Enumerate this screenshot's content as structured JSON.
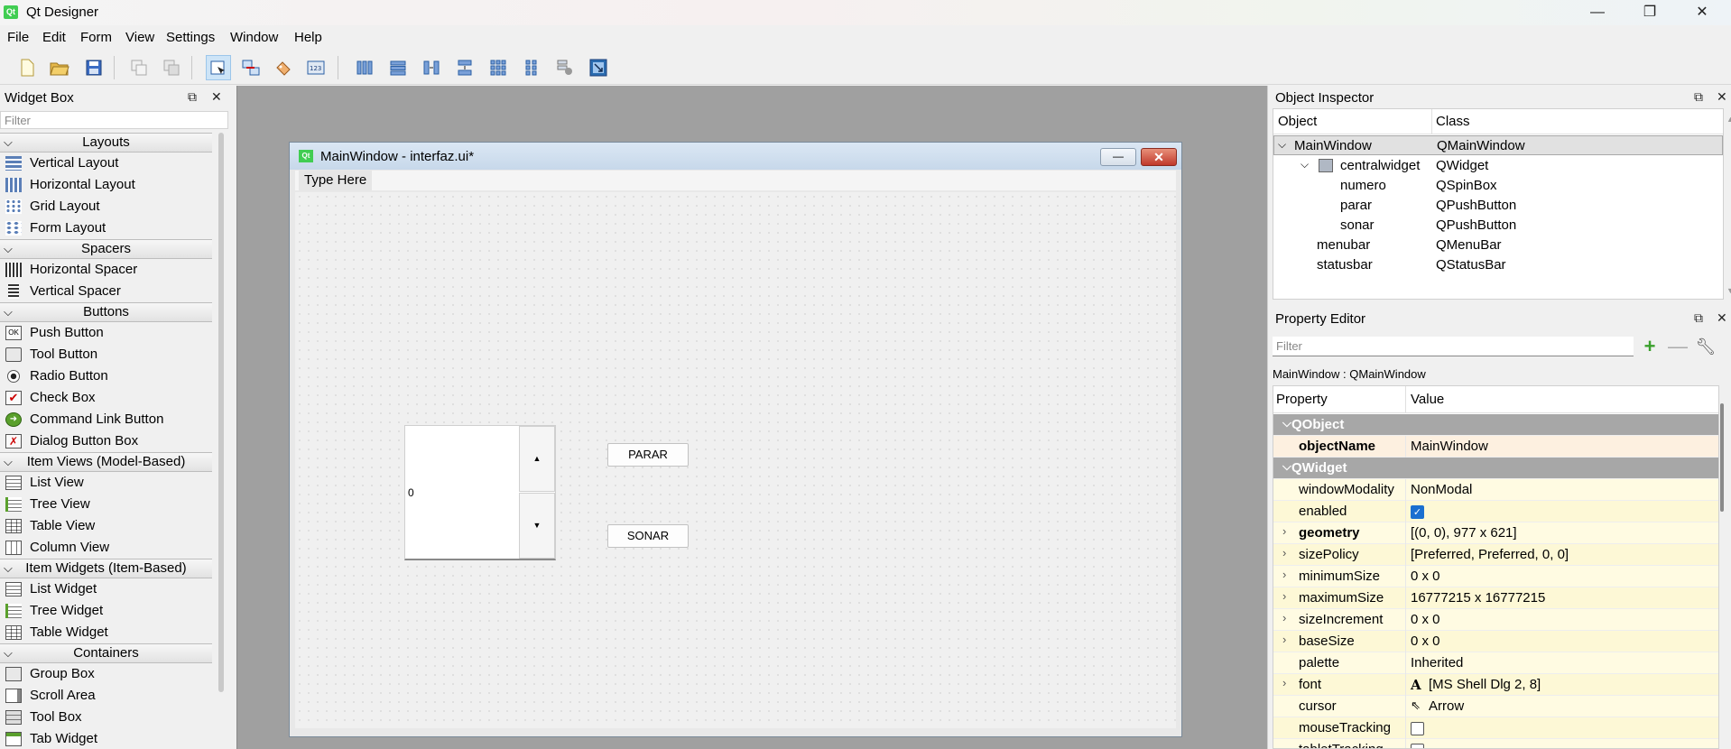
{
  "window": {
    "title": "Qt Designer",
    "icon_text": "Qt",
    "controls": {
      "minimize": "—",
      "maximize": "❐",
      "close": "✕"
    }
  },
  "menubar": [
    "File",
    "Edit",
    "Form",
    "View",
    "Settings",
    "Window",
    "Help"
  ],
  "widget_box": {
    "title": "Widget Box",
    "filter_placeholder": "Filter",
    "categories": [
      {
        "name": "Layouts",
        "items": [
          "Vertical Layout",
          "Horizontal Layout",
          "Grid Layout",
          "Form Layout"
        ]
      },
      {
        "name": "Spacers",
        "items": [
          "Horizontal Spacer",
          "Vertical Spacer"
        ]
      },
      {
        "name": "Buttons",
        "items": [
          "Push Button",
          "Tool Button",
          "Radio Button",
          "Check Box",
          "Command Link Button",
          "Dialog Button Box"
        ]
      },
      {
        "name": "Item Views (Model-Based)",
        "items": [
          "List View",
          "Tree View",
          "Table View",
          "Column View"
        ]
      },
      {
        "name": "Item Widgets (Item-Based)",
        "items": [
          "List Widget",
          "Tree Widget",
          "Table Widget"
        ]
      },
      {
        "name": "Containers",
        "items": [
          "Group Box",
          "Scroll Area",
          "Tool Box",
          "Tab Widget"
        ]
      }
    ]
  },
  "form": {
    "title": "MainWindow - interfaz.ui*",
    "menu_placeholder": "Type Here",
    "spinbox_value": "0",
    "spin_up": "▲",
    "spin_down": "▼",
    "button_parar": "PARAR",
    "button_sonar": "SONAR"
  },
  "object_inspector": {
    "title": "Object Inspector",
    "col_object": "Object",
    "col_class": "Class",
    "rows": [
      {
        "object": "MainWindow",
        "class": "QMainWindow"
      },
      {
        "object": "centralwidget",
        "class": "QWidget"
      },
      {
        "object": "numero",
        "class": "QSpinBox"
      },
      {
        "object": "parar",
        "class": "QPushButton"
      },
      {
        "object": "sonar",
        "class": "QPushButton"
      },
      {
        "object": "menubar",
        "class": "QMenuBar"
      },
      {
        "object": "statusbar",
        "class": "QStatusBar"
      }
    ]
  },
  "property_editor": {
    "title": "Property Editor",
    "filter_placeholder": "Filter",
    "object_label": "MainWindow : QMainWindow",
    "col_property": "Property",
    "col_value": "Value",
    "rows": [
      {
        "property": "QObject",
        "value": ""
      },
      {
        "property": "objectName",
        "value": "MainWindow"
      },
      {
        "property": "QWidget",
        "value": ""
      },
      {
        "property": "windowModality",
        "value": "NonModal"
      },
      {
        "property": "enabled",
        "value": ""
      },
      {
        "property": "geometry",
        "value": "[(0, 0), 977 x 621]"
      },
      {
        "property": "sizePolicy",
        "value": "[Preferred, Preferred, 0, 0]"
      },
      {
        "property": "minimumSize",
        "value": "0 x 0"
      },
      {
        "property": "maximumSize",
        "value": "16777215 x 16777215"
      },
      {
        "property": "sizeIncrement",
        "value": "0 x 0"
      },
      {
        "property": "baseSize",
        "value": "0 x 0"
      },
      {
        "property": "palette",
        "value": "Inherited"
      },
      {
        "property": "font",
        "value": "[MS Shell Dlg 2, 8]"
      },
      {
        "property": "cursor",
        "value": "Arrow"
      },
      {
        "property": "mouseTracking",
        "value": ""
      },
      {
        "property": "tabletTracking",
        "value": ""
      }
    ]
  },
  "colors": {
    "accent": "#1a6fd0",
    "group_header": "#a7a7a7",
    "qt_green": "#41cd52"
  }
}
